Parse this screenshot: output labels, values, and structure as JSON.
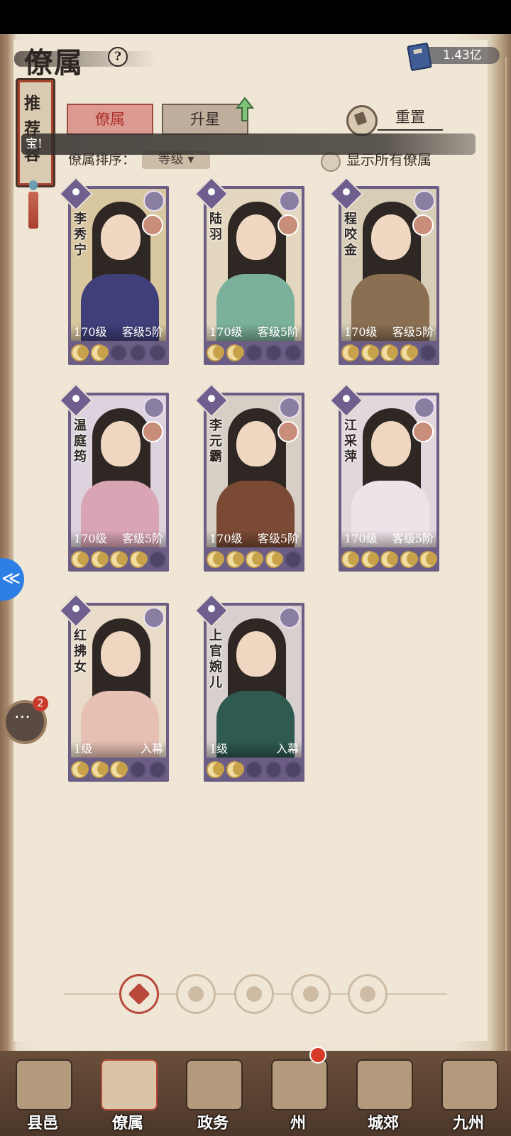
{
  "header": {
    "title": "僚属",
    "currency_value": "1.43亿"
  },
  "side_tag": {
    "text": "推荐容"
  },
  "tabs": [
    {
      "label": "僚属",
      "active": true
    },
    {
      "label": "升星",
      "active": false
    }
  ],
  "reset": {
    "label": "重置"
  },
  "toast": {
    "text": "宝!"
  },
  "sort": {
    "label": "僚属排序：",
    "value": "等级"
  },
  "toggle": {
    "label": "显示所有僚属"
  },
  "cards": [
    {
      "name": "李秀宁",
      "level": "170级",
      "rank": "客级5阶",
      "stars": 2,
      "robe": "#3f3f7a",
      "sky": "#d9c7a0"
    },
    {
      "name": "陆羽",
      "level": "170级",
      "rank": "客级5阶",
      "stars": 2,
      "robe": "#7bb09a",
      "sky": "#e3d8bf"
    },
    {
      "name": "程咬金",
      "level": "170级",
      "rank": "客级5阶",
      "stars": 4,
      "robe": "#8a6f52",
      "sky": "#d8cdb7"
    },
    {
      "name": "温庭筠",
      "level": "170级",
      "rank": "客级5阶",
      "stars": 4,
      "robe": "#d9a4b3",
      "sky": "#ddd3df"
    },
    {
      "name": "李元霸",
      "level": "170级",
      "rank": "客级5阶",
      "stars": 4,
      "robe": "#7a4a34",
      "sky": "#d7cfc6"
    },
    {
      "name": "江采萍",
      "level": "170级",
      "rank": "客级5阶",
      "stars": 5,
      "robe": "#efe3ea",
      "sky": "#e3d7de"
    },
    {
      "name": "红拂女",
      "level": "1级",
      "rank": "入幕",
      "stars": 3,
      "robe": "#e7c0b4",
      "sky": "#e8dcc9"
    },
    {
      "name": "上官婉儿",
      "level": "1级",
      "rank": "入幕",
      "stars": 2,
      "robe": "#2e5a4f",
      "sky": "#d8d0cf"
    }
  ],
  "chat": {
    "badge": "2"
  },
  "nav": [
    {
      "label": "县邑",
      "active": false
    },
    {
      "label": "僚属",
      "active": true
    },
    {
      "label": "政务",
      "active": false
    },
    {
      "label": "州",
      "active": false
    },
    {
      "label": "城郊",
      "active": false
    },
    {
      "label": "九州",
      "active": false
    }
  ]
}
